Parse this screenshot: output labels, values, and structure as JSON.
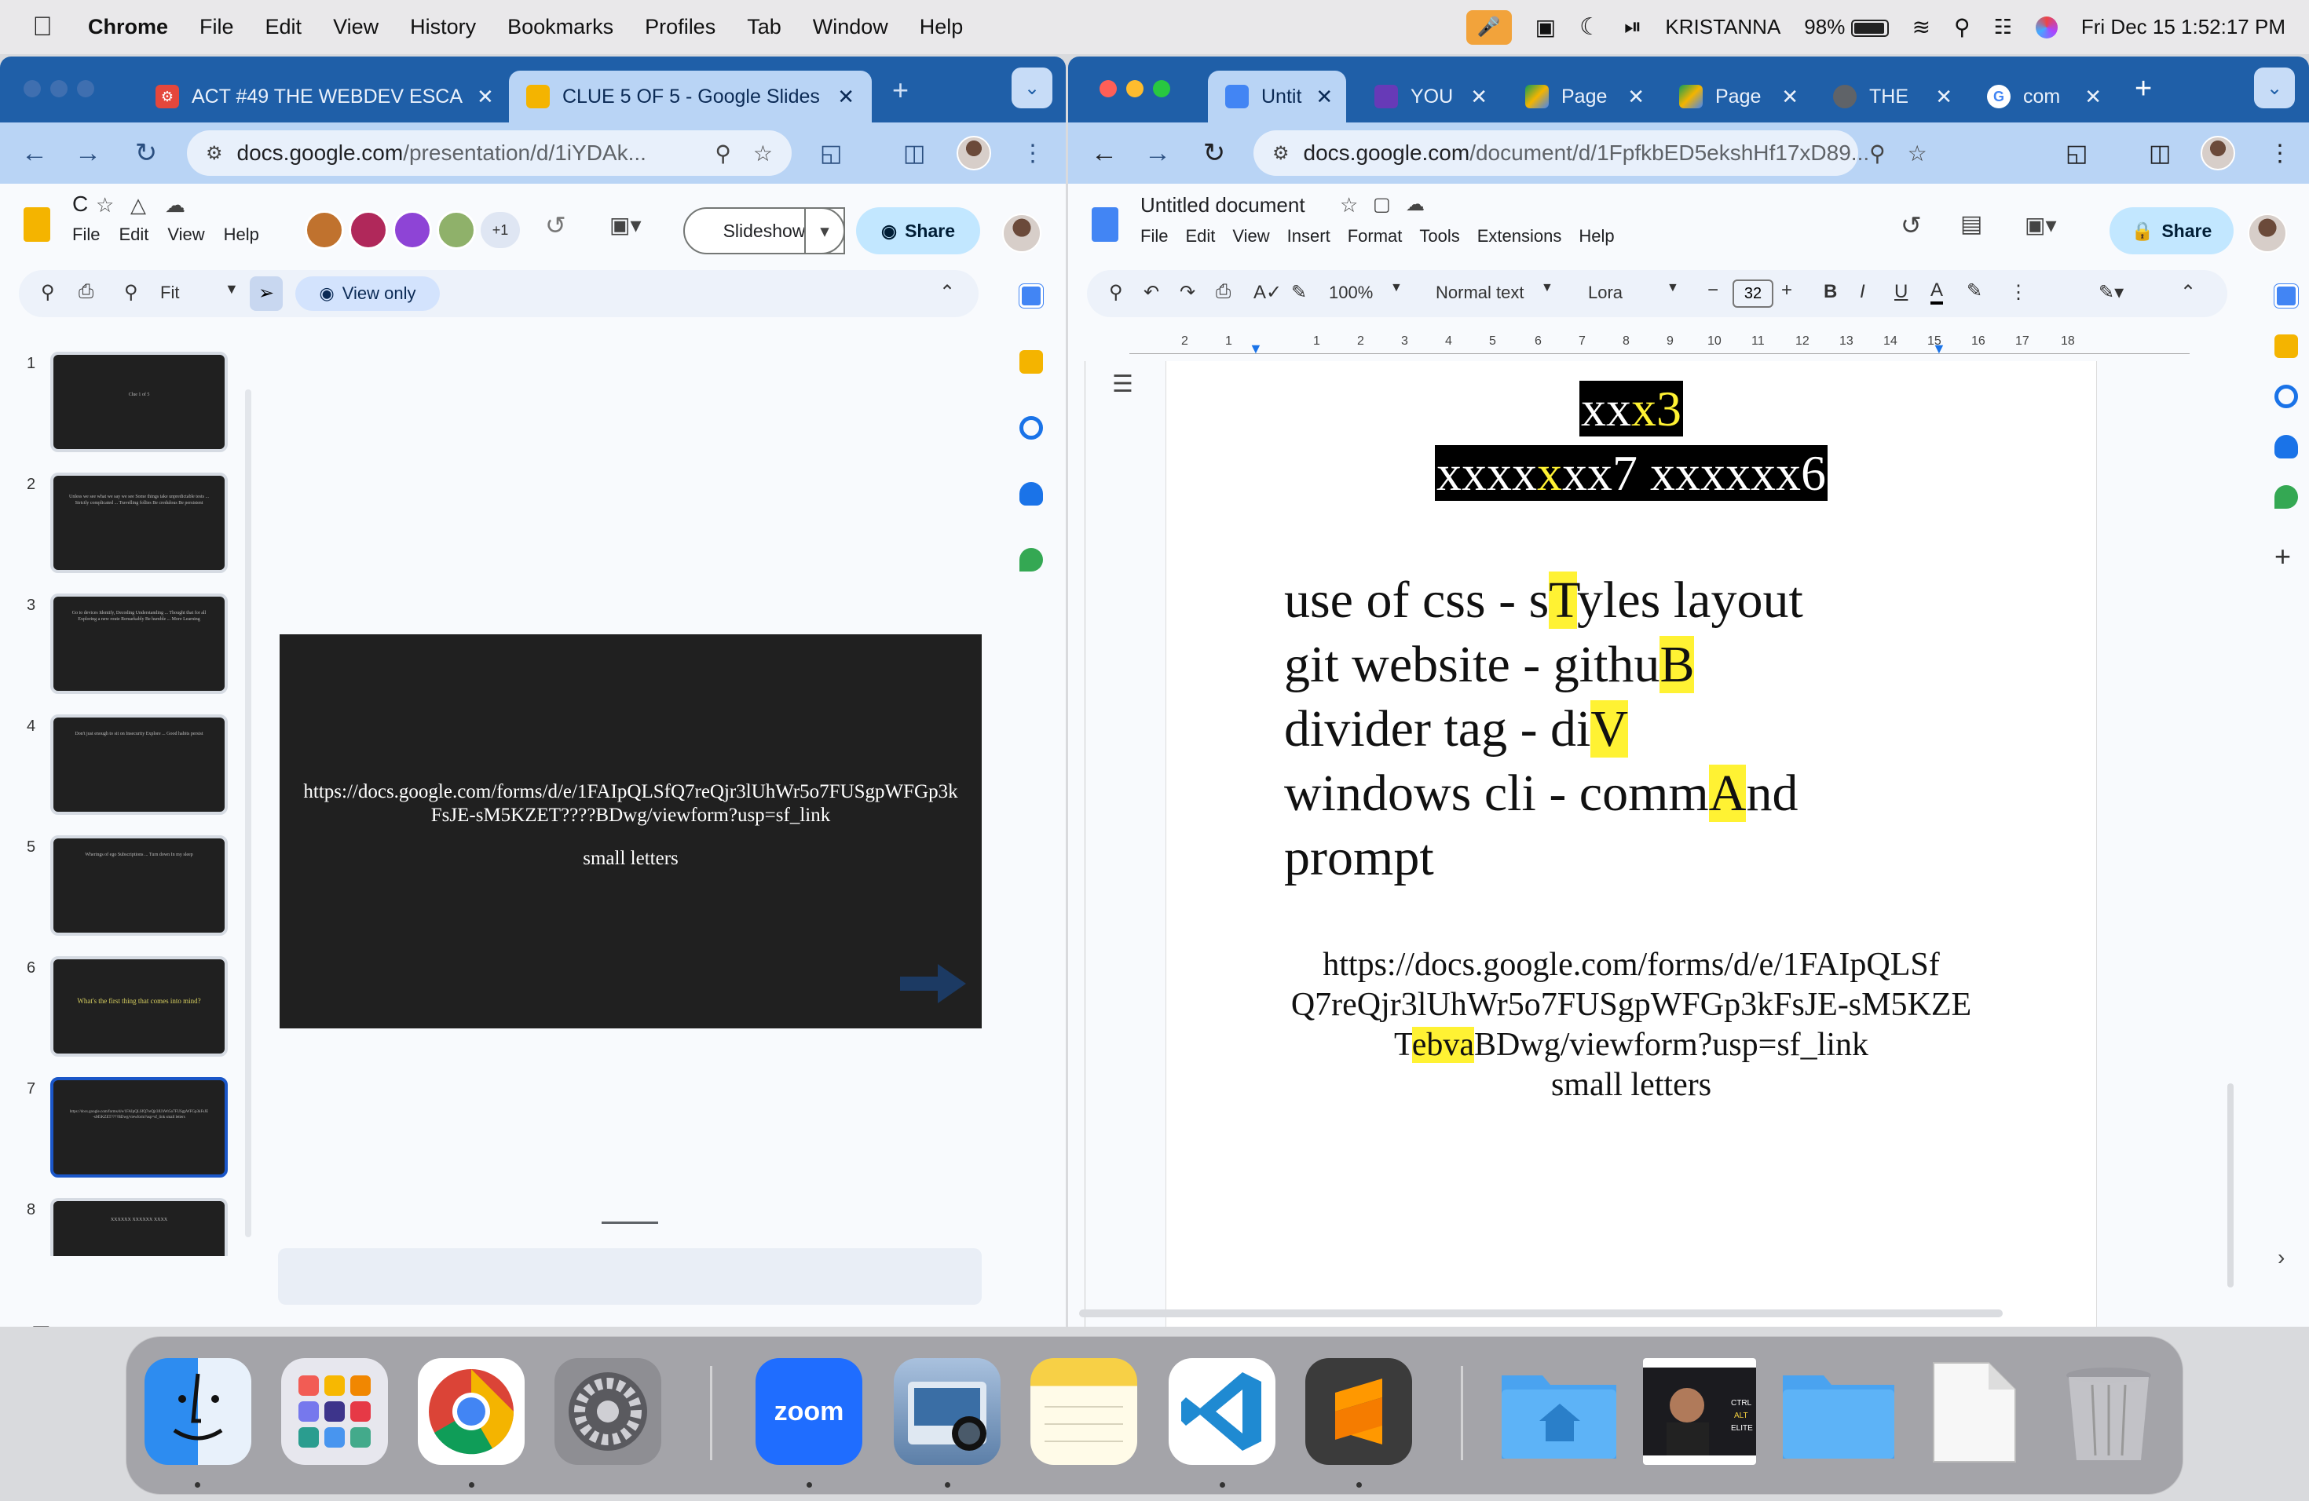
{
  "menubar": {
    "app": "Chrome",
    "items": [
      "File",
      "Edit",
      "View",
      "History",
      "Bookmarks",
      "Profiles",
      "Tab",
      "Window",
      "Help"
    ],
    "user": "KRISTANNA",
    "battery": "98%",
    "clock": "Fri Dec 15  1:52:17 PM"
  },
  "left": {
    "tabs": [
      {
        "label": "ACT #49 THE WEBDEV ESCA",
        "fav_color": "#e4473c"
      },
      {
        "label": "CLUE 5 OF 5 - Google Slides",
        "fav_color": "#f4b400"
      }
    ],
    "url_host": "docs.google.com",
    "url_path": "/presentation/d/1iYDAk...",
    "doc_title": "C",
    "menus": [
      "File",
      "Edit",
      "View",
      "Help"
    ],
    "collab_more": "+1",
    "slideshow": "Slideshow",
    "share": "Share",
    "zoom": "Fit",
    "view_only": "View only",
    "thumbs": [
      {
        "num": "1",
        "text": "Clue 1 of 5"
      },
      {
        "num": "2",
        "text": "Unless we see what we say we see Some things take unpredictable tests ... Strictly complicated ... Travelling follies Be credulous Be persistent"
      },
      {
        "num": "3",
        "text": "Go to devices Identify, Decoding Understanding ... Thought that for all Exploring a new route Remarkably Be humble ... More Learning"
      },
      {
        "num": "4",
        "text": "Don't just enough to sit on Insecurity Explore ... Good habits persist"
      },
      {
        "num": "5",
        "text": "Wherings of ego Subscriptions ... Turn down In my sleep"
      },
      {
        "num": "6",
        "text": "What's the first thing that comes into mind?"
      },
      {
        "num": "7",
        "text": "https://docs.google.com/forms/d/e/1FAIpQLSfQ7reQjr3lUhWr5o7FUSgpWFGp3kFsJE-sM5KZET????BDwg/viewform?usp=sf_link small letters"
      },
      {
        "num": "8",
        "text": "XXXXXX XXXXXX XXXX"
      }
    ],
    "slide_url": "https://docs.google.com/forms/d/e/1FAIpQLSfQ7reQjr3lUhWr5o7FUSgpWFGp3kFsJE-sM5KZET????BDwg/viewform?usp=sf_link",
    "slide_sub": "small letters"
  },
  "right": {
    "tabs": [
      {
        "label": "Untit",
        "fav_color": "#4285f4"
      },
      {
        "label": "YOU",
        "fav_color": "#673ab7"
      },
      {
        "label": "Page",
        "fav_color": "#0f9d58"
      },
      {
        "label": "Page",
        "fav_color": "#0f9d58"
      },
      {
        "label": "THE",
        "fav_color": "#5f6368"
      },
      {
        "label": "com",
        "fav_color": "#4285f4"
      }
    ],
    "url_host": "docs.google.com",
    "url_path": "/document/d/1FpfkbED5ekshHf17xD89...",
    "doc_title": "Untitled document",
    "menus": [
      "File",
      "Edit",
      "View",
      "Insert",
      "Format",
      "Tools",
      "Extensions",
      "Help"
    ],
    "share": "Share",
    "zoom": "100%",
    "style": "Normal text",
    "font": "Lora",
    "size": "32",
    "ruler": [
      "2",
      "1",
      "1",
      "2",
      "3",
      "4",
      "5",
      "6",
      "7",
      "8",
      "9",
      "10",
      "11",
      "12",
      "13",
      "14",
      "15",
      "16",
      "17",
      "18"
    ],
    "title1": {
      "a": "xx",
      "b": "x",
      "c": "3"
    },
    "title2": {
      "a": "xxxx",
      "b": "x",
      "c": "xx7 xxxxxx6"
    },
    "lines": [
      {
        "pre": "use of css - s",
        "hl": "T",
        "post": "yles layout"
      },
      {
        "pre": "git website - githu",
        "hl": "B",
        "post": ""
      },
      {
        "pre": "divider tag - di",
        "hl": "V",
        "post": ""
      },
      {
        "pre": "windows cli - comm",
        "hl": "A",
        "post": "nd"
      },
      {
        "pre": "prompt",
        "hl": "",
        "post": ""
      }
    ],
    "url_line1": "https://docs.google.com/forms/d/e/1FAIpQLSf",
    "url_line2": "Q7reQjr3lUhWr5o7FUSgpWFGp3kFsJE-sM5KZE",
    "url_line3_pre": "T",
    "url_line3_hl": "ebva",
    "url_line3_post": "BDwg/viewform?usp=sf_link",
    "small_letters": "small letters"
  },
  "dock": [
    {
      "name": "Finder",
      "color": "#3b9cf3"
    },
    {
      "name": "Launchpad",
      "color": "#e8e8ee"
    },
    {
      "name": "Chrome",
      "color": "#ffffff"
    },
    {
      "name": "System Settings",
      "color": "#8a8a8f"
    },
    {
      "name": "zoom",
      "color": "#1f6dff"
    },
    {
      "name": "Preview",
      "color": "#c9d6e6"
    },
    {
      "name": "Notes",
      "color": "#fff8d8"
    },
    {
      "name": "VS Code",
      "color": "#ffffff"
    },
    {
      "name": "Sublime Text",
      "color": "#3b3b3b"
    },
    {
      "name": "Home Folder",
      "color": "#4aa3f0"
    },
    {
      "name": "Video",
      "color": "#222222"
    },
    {
      "name": "Folder",
      "color": "#4aa3f0"
    },
    {
      "name": "Document",
      "color": "#f4f4f4"
    },
    {
      "name": "Trash",
      "color": "#c8c8cc"
    }
  ]
}
